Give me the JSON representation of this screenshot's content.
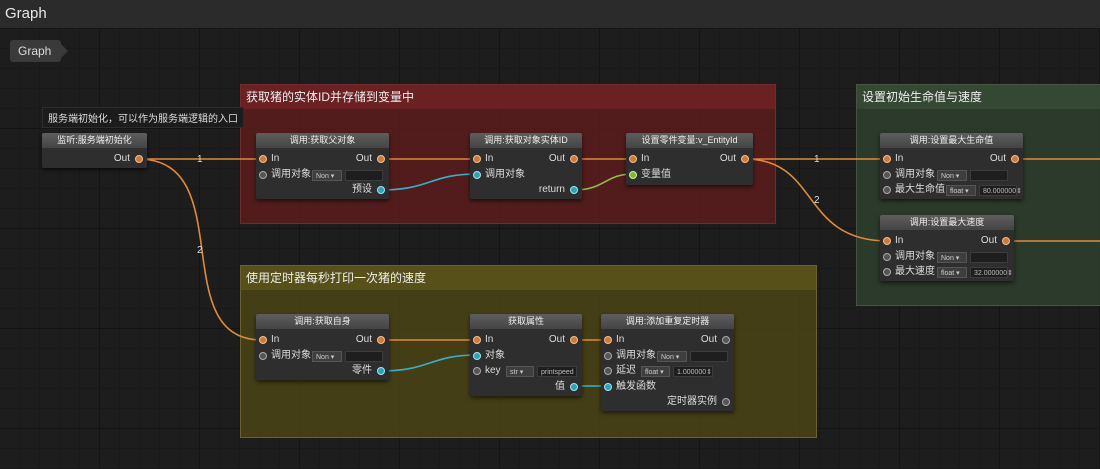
{
  "window": {
    "title": "Graph"
  },
  "breadcrumb": {
    "label": "Graph"
  },
  "colors": {
    "exec_wire": "#e08a3a",
    "data_wire": "#3ab0c8",
    "bool_wire": "#8cc04a"
  },
  "comments": [
    {
      "title": "获取猪的实体ID并存储到变量中"
    },
    {
      "title": "使用定时器每秒打印一次猪的速度"
    },
    {
      "title": "设置初始生命值与速度"
    }
  ],
  "note": "服务端初始化，可以作为服务端逻辑的入口",
  "wire_labels": {
    "w1": "1",
    "w2": "2",
    "w3": "1",
    "w4": "2"
  },
  "nodes": {
    "listen": {
      "title": "监听:服务端初始化",
      "out": "Out"
    },
    "getParent": {
      "title": "调用:获取父对象",
      "in": "In",
      "out": "Out",
      "target": "调用对象",
      "target_val": "Non",
      "ret": "预设"
    },
    "getEntityId": {
      "title": "调用:获取对象实体ID",
      "in": "In",
      "out": "Out",
      "target": "调用对象",
      "ret": "return"
    },
    "setVar": {
      "title": "设置零件变量:v_EntityId",
      "in": "In",
      "out": "Out",
      "value": "变量值"
    },
    "setMaxHealth": {
      "title": "调用:设置最大生命值",
      "in": "In",
      "out": "Out",
      "target": "调用对象",
      "target_val": "Non",
      "param": "最大生命值",
      "param_type": "float",
      "param_val": "80.000000"
    },
    "setMaxSpeed": {
      "title": "调用:设置最大速度",
      "in": "In",
      "out": "Out",
      "target": "调用对象",
      "target_val": "Non",
      "param": "最大速度",
      "param_type": "float",
      "param_val": "32.000000"
    },
    "getSelf": {
      "title": "调用:获取自身",
      "in": "In",
      "out": "Out",
      "target": "调用对象",
      "target_val": "Non",
      "ret": "零件"
    },
    "getAttr": {
      "title": "获取属性",
      "in": "In",
      "out": "Out",
      "obj": "对象",
      "key": "key",
      "key_type": "str",
      "key_val": "printspeed",
      "ret": "值"
    },
    "addTimer": {
      "title": "调用:添加重复定时器",
      "in": "In",
      "out": "Out",
      "target": "调用对象",
      "target_val": "Non",
      "delay": "延迟",
      "delay_type": "float",
      "delay_val": "1.000000",
      "func": "触发函数",
      "ret": "定时器实例"
    }
  }
}
